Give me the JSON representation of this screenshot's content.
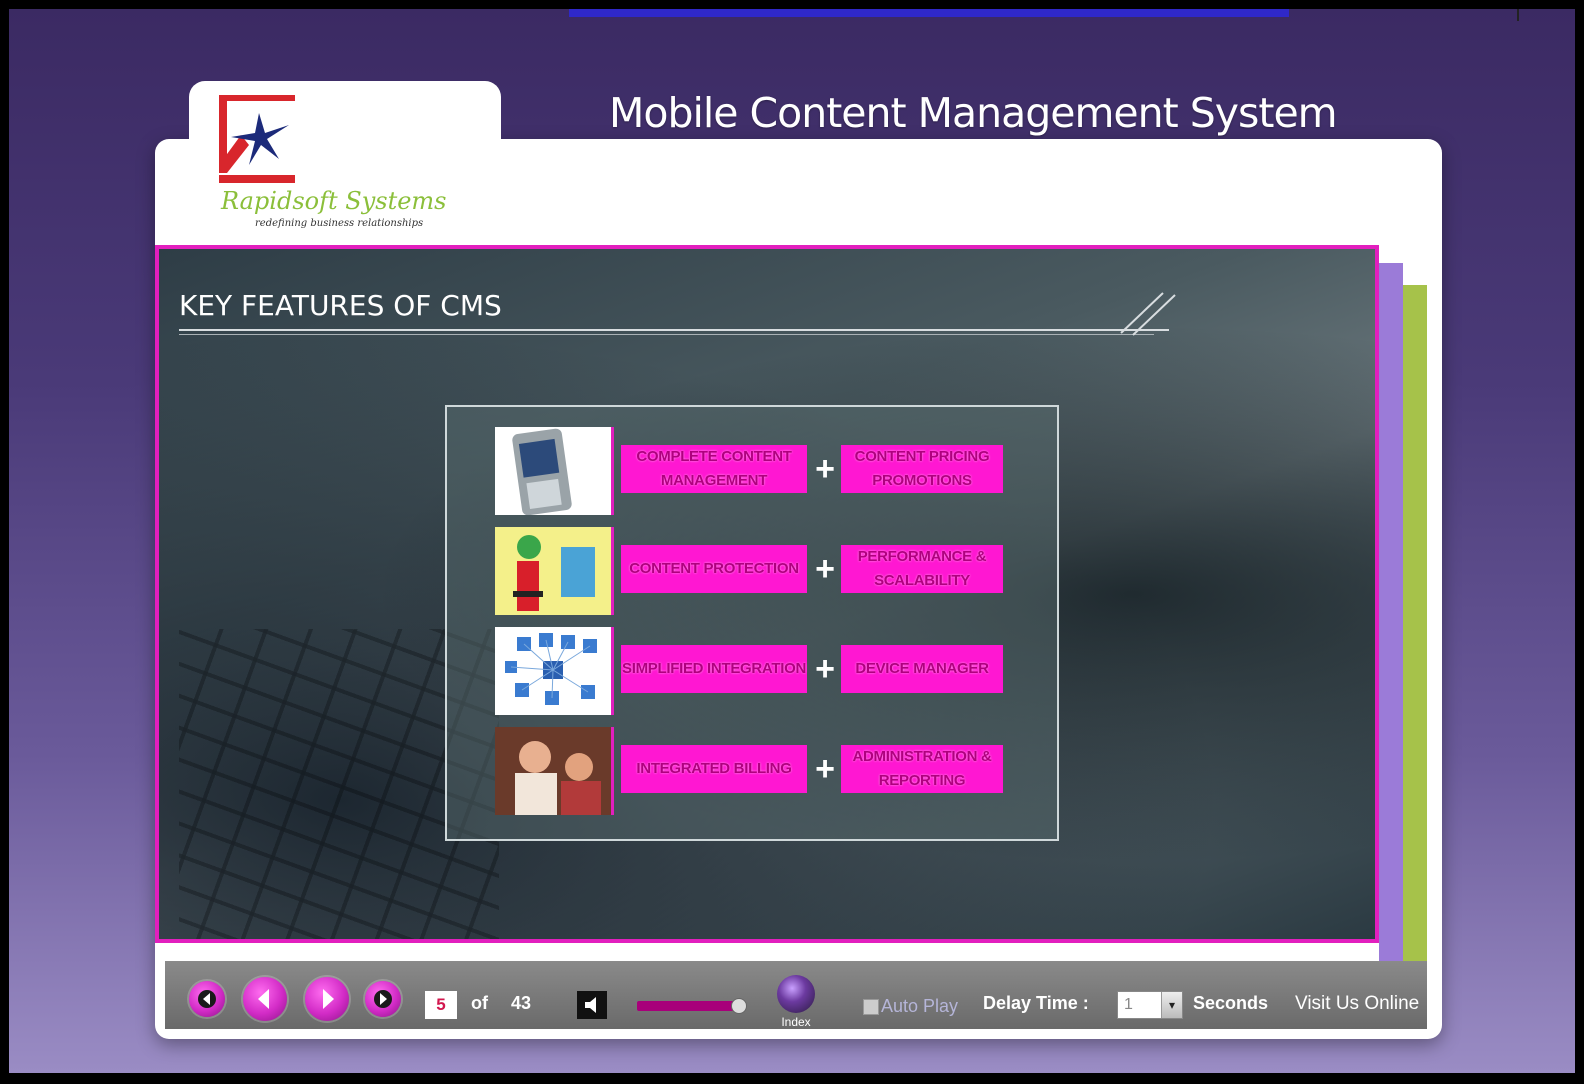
{
  "header": {
    "app_title": "Mobile Content Management System",
    "brand_name": "Rapidsoft Systems",
    "brand_tagline": "redefining business relationships"
  },
  "slide": {
    "title": "KEY FEATURES OF CMS",
    "rows": [
      {
        "left": "COMPLETE CONTENT MANAGEMENT",
        "right": "CONTENT PRICING PROMOTIONS",
        "icon": "mobile-phone-image"
      },
      {
        "left": "CONTENT PROTECTION",
        "right": "PERFORMANCE & SCALABILITY",
        "icon": "protection-illustration-image"
      },
      {
        "left": "SIMPLIFIED INTEGRATION",
        "right": "DEVICE MANAGER",
        "icon": "network-diagram-image"
      },
      {
        "left": "INTEGRATED BILLING",
        "right": "ADMINISTRATION & REPORTING",
        "icon": "people-billing-image"
      }
    ],
    "plus": "+"
  },
  "toolbar": {
    "current_page": "5",
    "of_label": "of",
    "total_pages": "43",
    "index_label": "Index",
    "autoplay_label": "Auto Play",
    "delay_label": "Delay Time :",
    "delay_value": "1",
    "seconds_label": "Seconds",
    "visit_label": "Visit Us Online",
    "volume_level": 0.92
  },
  "colors": {
    "accent_magenta": "#ff17d2",
    "brand_green": "#8bbf3a",
    "frame_purple": "#9b7bd8"
  }
}
